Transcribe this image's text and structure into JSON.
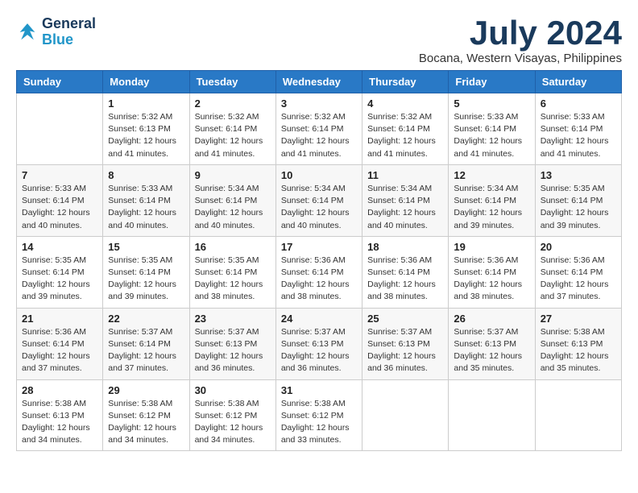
{
  "logo": {
    "line1": "General",
    "line2": "Blue"
  },
  "title": "July 2024",
  "location": "Bocana, Western Visayas, Philippines",
  "days_header": [
    "Sunday",
    "Monday",
    "Tuesday",
    "Wednesday",
    "Thursday",
    "Friday",
    "Saturday"
  ],
  "weeks": [
    [
      {
        "num": "",
        "sunrise": "",
        "sunset": "",
        "daylight": "",
        "empty": true
      },
      {
        "num": "1",
        "sunrise": "Sunrise: 5:32 AM",
        "sunset": "Sunset: 6:13 PM",
        "daylight": "Daylight: 12 hours",
        "minutes": "and 41 minutes."
      },
      {
        "num": "2",
        "sunrise": "Sunrise: 5:32 AM",
        "sunset": "Sunset: 6:14 PM",
        "daylight": "Daylight: 12 hours",
        "minutes": "and 41 minutes."
      },
      {
        "num": "3",
        "sunrise": "Sunrise: 5:32 AM",
        "sunset": "Sunset: 6:14 PM",
        "daylight": "Daylight: 12 hours",
        "minutes": "and 41 minutes."
      },
      {
        "num": "4",
        "sunrise": "Sunrise: 5:32 AM",
        "sunset": "Sunset: 6:14 PM",
        "daylight": "Daylight: 12 hours",
        "minutes": "and 41 minutes."
      },
      {
        "num": "5",
        "sunrise": "Sunrise: 5:33 AM",
        "sunset": "Sunset: 6:14 PM",
        "daylight": "Daylight: 12 hours",
        "minutes": "and 41 minutes."
      },
      {
        "num": "6",
        "sunrise": "Sunrise: 5:33 AM",
        "sunset": "Sunset: 6:14 PM",
        "daylight": "Daylight: 12 hours",
        "minutes": "and 41 minutes."
      }
    ],
    [
      {
        "num": "7",
        "sunrise": "Sunrise: 5:33 AM",
        "sunset": "Sunset: 6:14 PM",
        "daylight": "Daylight: 12 hours",
        "minutes": "and 40 minutes."
      },
      {
        "num": "8",
        "sunrise": "Sunrise: 5:33 AM",
        "sunset": "Sunset: 6:14 PM",
        "daylight": "Daylight: 12 hours",
        "minutes": "and 40 minutes."
      },
      {
        "num": "9",
        "sunrise": "Sunrise: 5:34 AM",
        "sunset": "Sunset: 6:14 PM",
        "daylight": "Daylight: 12 hours",
        "minutes": "and 40 minutes."
      },
      {
        "num": "10",
        "sunrise": "Sunrise: 5:34 AM",
        "sunset": "Sunset: 6:14 PM",
        "daylight": "Daylight: 12 hours",
        "minutes": "and 40 minutes."
      },
      {
        "num": "11",
        "sunrise": "Sunrise: 5:34 AM",
        "sunset": "Sunset: 6:14 PM",
        "daylight": "Daylight: 12 hours",
        "minutes": "and 40 minutes."
      },
      {
        "num": "12",
        "sunrise": "Sunrise: 5:34 AM",
        "sunset": "Sunset: 6:14 PM",
        "daylight": "Daylight: 12 hours",
        "minutes": "and 39 minutes."
      },
      {
        "num": "13",
        "sunrise": "Sunrise: 5:35 AM",
        "sunset": "Sunset: 6:14 PM",
        "daylight": "Daylight: 12 hours",
        "minutes": "and 39 minutes."
      }
    ],
    [
      {
        "num": "14",
        "sunrise": "Sunrise: 5:35 AM",
        "sunset": "Sunset: 6:14 PM",
        "daylight": "Daylight: 12 hours",
        "minutes": "and 39 minutes."
      },
      {
        "num": "15",
        "sunrise": "Sunrise: 5:35 AM",
        "sunset": "Sunset: 6:14 PM",
        "daylight": "Daylight: 12 hours",
        "minutes": "and 39 minutes."
      },
      {
        "num": "16",
        "sunrise": "Sunrise: 5:35 AM",
        "sunset": "Sunset: 6:14 PM",
        "daylight": "Daylight: 12 hours",
        "minutes": "and 38 minutes."
      },
      {
        "num": "17",
        "sunrise": "Sunrise: 5:36 AM",
        "sunset": "Sunset: 6:14 PM",
        "daylight": "Daylight: 12 hours",
        "minutes": "and 38 minutes."
      },
      {
        "num": "18",
        "sunrise": "Sunrise: 5:36 AM",
        "sunset": "Sunset: 6:14 PM",
        "daylight": "Daylight: 12 hours",
        "minutes": "and 38 minutes."
      },
      {
        "num": "19",
        "sunrise": "Sunrise: 5:36 AM",
        "sunset": "Sunset: 6:14 PM",
        "daylight": "Daylight: 12 hours",
        "minutes": "and 38 minutes."
      },
      {
        "num": "20",
        "sunrise": "Sunrise: 5:36 AM",
        "sunset": "Sunset: 6:14 PM",
        "daylight": "Daylight: 12 hours",
        "minutes": "and 37 minutes."
      }
    ],
    [
      {
        "num": "21",
        "sunrise": "Sunrise: 5:36 AM",
        "sunset": "Sunset: 6:14 PM",
        "daylight": "Daylight: 12 hours",
        "minutes": "and 37 minutes."
      },
      {
        "num": "22",
        "sunrise": "Sunrise: 5:37 AM",
        "sunset": "Sunset: 6:14 PM",
        "daylight": "Daylight: 12 hours",
        "minutes": "and 37 minutes."
      },
      {
        "num": "23",
        "sunrise": "Sunrise: 5:37 AM",
        "sunset": "Sunset: 6:13 PM",
        "daylight": "Daylight: 12 hours",
        "minutes": "and 36 minutes."
      },
      {
        "num": "24",
        "sunrise": "Sunrise: 5:37 AM",
        "sunset": "Sunset: 6:13 PM",
        "daylight": "Daylight: 12 hours",
        "minutes": "and 36 minutes."
      },
      {
        "num": "25",
        "sunrise": "Sunrise: 5:37 AM",
        "sunset": "Sunset: 6:13 PM",
        "daylight": "Daylight: 12 hours",
        "minutes": "and 36 minutes."
      },
      {
        "num": "26",
        "sunrise": "Sunrise: 5:37 AM",
        "sunset": "Sunset: 6:13 PM",
        "daylight": "Daylight: 12 hours",
        "minutes": "and 35 minutes."
      },
      {
        "num": "27",
        "sunrise": "Sunrise: 5:38 AM",
        "sunset": "Sunset: 6:13 PM",
        "daylight": "Daylight: 12 hours",
        "minutes": "and 35 minutes."
      }
    ],
    [
      {
        "num": "28",
        "sunrise": "Sunrise: 5:38 AM",
        "sunset": "Sunset: 6:13 PM",
        "daylight": "Daylight: 12 hours",
        "minutes": "and 34 minutes."
      },
      {
        "num": "29",
        "sunrise": "Sunrise: 5:38 AM",
        "sunset": "Sunset: 6:12 PM",
        "daylight": "Daylight: 12 hours",
        "minutes": "and 34 minutes."
      },
      {
        "num": "30",
        "sunrise": "Sunrise: 5:38 AM",
        "sunset": "Sunset: 6:12 PM",
        "daylight": "Daylight: 12 hours",
        "minutes": "and 34 minutes."
      },
      {
        "num": "31",
        "sunrise": "Sunrise: 5:38 AM",
        "sunset": "Sunset: 6:12 PM",
        "daylight": "Daylight: 12 hours",
        "minutes": "and 33 minutes."
      },
      {
        "num": "",
        "sunrise": "",
        "sunset": "",
        "daylight": "",
        "empty": true
      },
      {
        "num": "",
        "sunrise": "",
        "sunset": "",
        "daylight": "",
        "empty": true
      },
      {
        "num": "",
        "sunrise": "",
        "sunset": "",
        "daylight": "",
        "empty": true
      }
    ]
  ]
}
